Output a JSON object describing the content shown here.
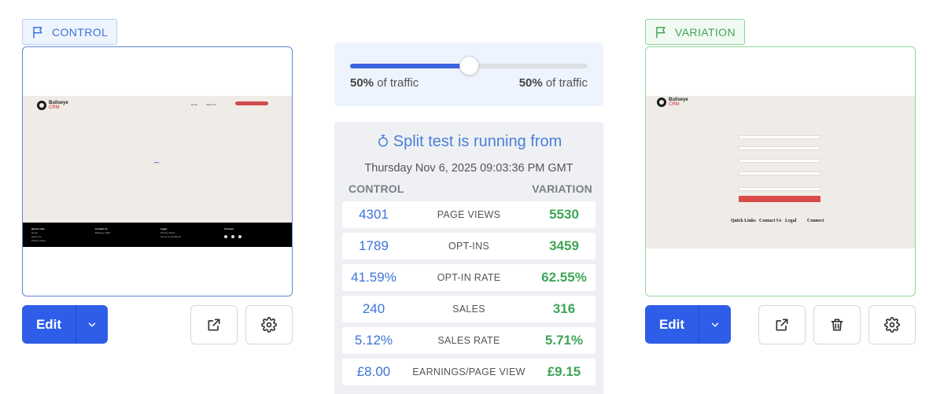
{
  "control": {
    "badge": "CONTROL",
    "edit_label": "Edit",
    "preview": {
      "logo_name": "Bullseye",
      "logo_sub": "CRM",
      "footer_cols": [
        {
          "title": "Quick Links",
          "items": [
            "Home",
            "About Us",
            "Privacy Policy"
          ]
        },
        {
          "title": "Contact Us",
          "items": [
            "Bullseye CRM"
          ]
        },
        {
          "title": "Legal",
          "items": [
            "Privacy Policy",
            "Terms & Conditions"
          ]
        },
        {
          "title": "Connect",
          "items": []
        }
      ]
    }
  },
  "variation": {
    "badge": "VARIATION",
    "edit_label": "Edit",
    "preview": {
      "logo_name": "Bullseye",
      "logo_sub": "CRM",
      "footer_cols": [
        "Quick Links",
        "Contact Us",
        "Legal",
        "Connect"
      ]
    }
  },
  "traffic": {
    "control_percent": "50%",
    "variation_percent": "50%",
    "suffix": "of traffic",
    "split_fraction": 0.5
  },
  "test": {
    "status": "Split test is running from",
    "started": "Thursday Nov 6, 2025 09:03:36 PM GMT",
    "col_control": "CONTROL",
    "col_variation": "VARIATION",
    "rows": [
      {
        "metric": "PAGE VIEWS",
        "control": "4301",
        "variation": "5530"
      },
      {
        "metric": "OPT-INS",
        "control": "1789",
        "variation": "3459"
      },
      {
        "metric": "OPT-IN RATE",
        "control": "41.59%",
        "variation": "62.55%"
      },
      {
        "metric": "SALES",
        "control": "240",
        "variation": "316"
      },
      {
        "metric": "SALES RATE",
        "control": "5.12%",
        "variation": "5.71%"
      },
      {
        "metric": "EARNINGS/PAGE VIEW",
        "control": "£8.00",
        "variation": "£9.15"
      }
    ]
  },
  "icons": [
    "flag-icon",
    "chevron-down-icon",
    "external-link-icon",
    "gear-icon",
    "trash-icon",
    "stopwatch-icon"
  ],
  "colors": {
    "primary": "#2e5ee8",
    "control": "#3d72d9",
    "variation": "#3fa556"
  }
}
